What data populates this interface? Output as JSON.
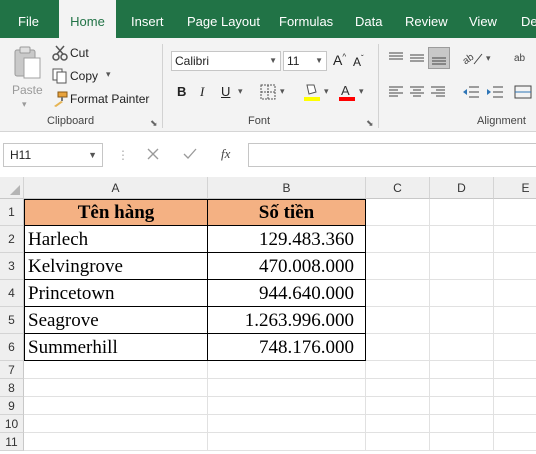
{
  "tabs": [
    {
      "label": "File",
      "active": false
    },
    {
      "label": "Home",
      "active": true
    },
    {
      "label": "Insert",
      "active": false
    },
    {
      "label": "Page Layout",
      "active": false
    },
    {
      "label": "Formulas",
      "active": false
    },
    {
      "label": "Data",
      "active": false
    },
    {
      "label": "Review",
      "active": false
    },
    {
      "label": "View",
      "active": false
    },
    {
      "label": "De",
      "active": false
    }
  ],
  "clipboard": {
    "paste_label": "Paste",
    "cut_label": "Cut",
    "copy_label": "Copy",
    "format_painter_label": "Format Painter",
    "group_label": "Clipboard"
  },
  "font": {
    "font_name": "Calibri",
    "font_size": "11",
    "bold": "B",
    "italic": "I",
    "underline": "U",
    "group_label": "Font",
    "highlight_color": "#ffff00",
    "font_color": "#ff0000"
  },
  "alignment": {
    "group_label": "Alignment"
  },
  "formula_bar": {
    "name_box": "H11",
    "fx_label": "fx",
    "formula": ""
  },
  "grid": {
    "columns": [
      "A",
      "B",
      "C",
      "D",
      "E"
    ],
    "rows": [
      "1",
      "2",
      "3",
      "4",
      "5",
      "6",
      "7",
      "8",
      "9",
      "10",
      "11"
    ],
    "header_fill": "#f4b183",
    "table": {
      "headers": [
        "Tên hàng",
        "Số tiền"
      ],
      "rows": [
        [
          "Harlech",
          "129.483.360"
        ],
        [
          "Kelvingrove",
          "470.008.000"
        ],
        [
          "Princetown",
          "944.640.000"
        ],
        [
          "Seagrove",
          "1.263.996.000"
        ],
        [
          "Summerhill",
          "748.176.000"
        ]
      ]
    }
  }
}
